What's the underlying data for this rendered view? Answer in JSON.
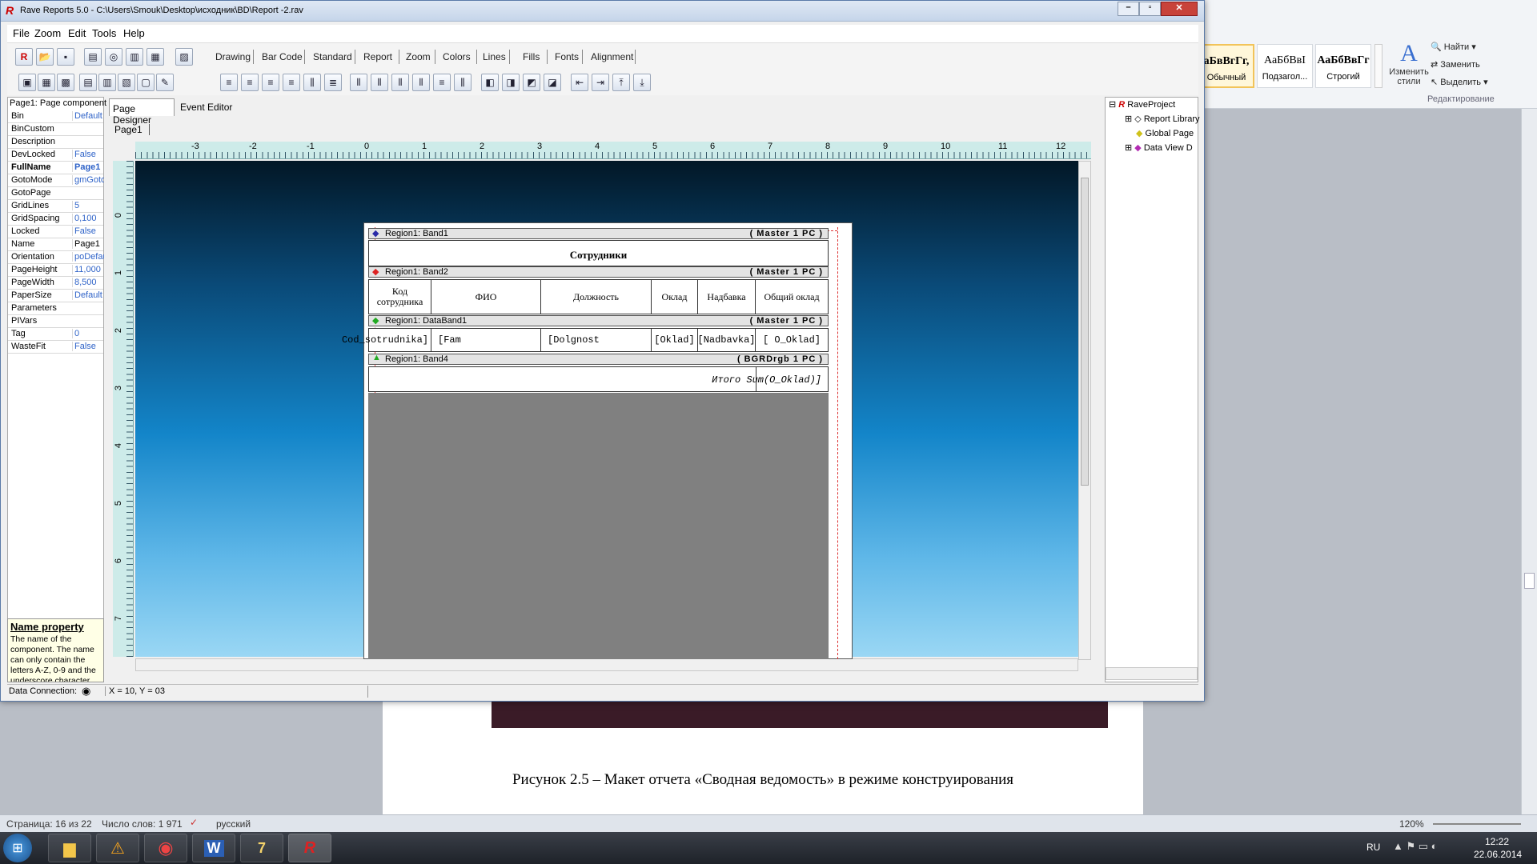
{
  "word": {
    "styles": [
      {
        "preview": "аБвВгГг,",
        "name": "Обычный"
      },
      {
        "preview": "АаБбВвI",
        "name": "Подзагол..."
      },
      {
        "preview": "АаБбВвГг",
        "name": "Строгий"
      }
    ],
    "change_styles": "Изменить стили",
    "find": "Найти",
    "replace": "Заменить",
    "select": "Выделить",
    "editing_group": "Редактирование",
    "caption": "Рисунок 2.5 – Макет отчета «Сводная ведомость» в режиме конструирования",
    "status": {
      "page": "Страница: 16 из 22",
      "words": "Число слов: 1 971",
      "language": "русский",
      "zoom": "120%"
    }
  },
  "taskbar": {
    "lang": "RU",
    "time": "12:22",
    "date": "22.06.2014"
  },
  "rave": {
    "title": "Rave Reports 5.0 - C:\\Users\\Smouk\\Desktop\\исходник\\BD\\Report -2.rav",
    "menu": [
      "File",
      "Zoom",
      "Edit",
      "Tools",
      "Help"
    ],
    "toolbar_tabs": [
      "Drawing",
      "Bar Code",
      "Standard",
      "Report",
      "Zoom",
      "Colors",
      "Lines",
      "Fills",
      "Fonts",
      "Alignment"
    ],
    "props_header": "Page1: Page component",
    "props": [
      {
        "k": "Bin",
        "v": "Default"
      },
      {
        "k": "BinCustom",
        "v": ""
      },
      {
        "k": "Description",
        "v": ""
      },
      {
        "k": "DevLocked",
        "v": "False"
      },
      {
        "k": "FullName",
        "v": "Page1"
      },
      {
        "k": "GotoMode",
        "v": "gmGoto"
      },
      {
        "k": "GotoPage",
        "v": ""
      },
      {
        "k": "GridLines",
        "v": "5"
      },
      {
        "k": "GridSpacing",
        "v": "0,100"
      },
      {
        "k": "Locked",
        "v": "False"
      },
      {
        "k": "Name",
        "v": "Page1"
      },
      {
        "k": "Orientation",
        "v": "poDefau"
      },
      {
        "k": "PageHeight",
        "v": "11,000"
      },
      {
        "k": "PageWidth",
        "v": "8,500"
      },
      {
        "k": "PaperSize",
        "v": "Default"
      },
      {
        "k": "Parameters",
        "v": ""
      },
      {
        "k": "PIVars",
        "v": ""
      },
      {
        "k": "Tag",
        "v": "0"
      },
      {
        "k": "WasteFit",
        "v": "False"
      }
    ],
    "help_title": "Name property",
    "help_text": "The name of the component. The name can only contain the letters A-Z, 0-9 and the underscore character.",
    "designer_tabs": [
      "Page Designer",
      "Event Editor"
    ],
    "page_tab": "Page1",
    "ruler_h": [
      "-3",
      "-2",
      "-1",
      "0",
      "1",
      "2",
      "3",
      "4",
      "5",
      "6",
      "7",
      "8",
      "9",
      "10",
      "11",
      "12"
    ],
    "ruler_v": [
      "0",
      "1",
      "2",
      "3",
      "4",
      "5",
      "6",
      "7"
    ],
    "bands": {
      "band1": {
        "name": "Region1: Band1",
        "master": "( Master 1 PC )"
      },
      "title": "Сотрудники",
      "band2": {
        "name": "Region1: Band2",
        "master": "( Master 1 PC )"
      },
      "headers": [
        "Код сотрудника",
        "ФИО",
        "Должность",
        "Оклад",
        "Надбавка",
        "Общий оклад"
      ],
      "databand": {
        "name": "Region1: DataBand1",
        "master": "( Master 1 PC )"
      },
      "fields": [
        "Cod_sotrudnika]",
        "[Fam",
        "[Dolgnost",
        "[Oklad]",
        "[Nadbavka]",
        "[ O_Oklad]"
      ],
      "band4": {
        "name": "Region1: Band4",
        "master": "( BGRDrgb 1 PC )"
      },
      "total": "Итого Sum(O_Oklad)]"
    },
    "tree": [
      "RaveProject",
      "Report Library",
      "Global Page",
      "Data View D"
    ],
    "status": {
      "connection": "Data Connection:",
      "coords": "X = 10, Y = 03"
    }
  }
}
